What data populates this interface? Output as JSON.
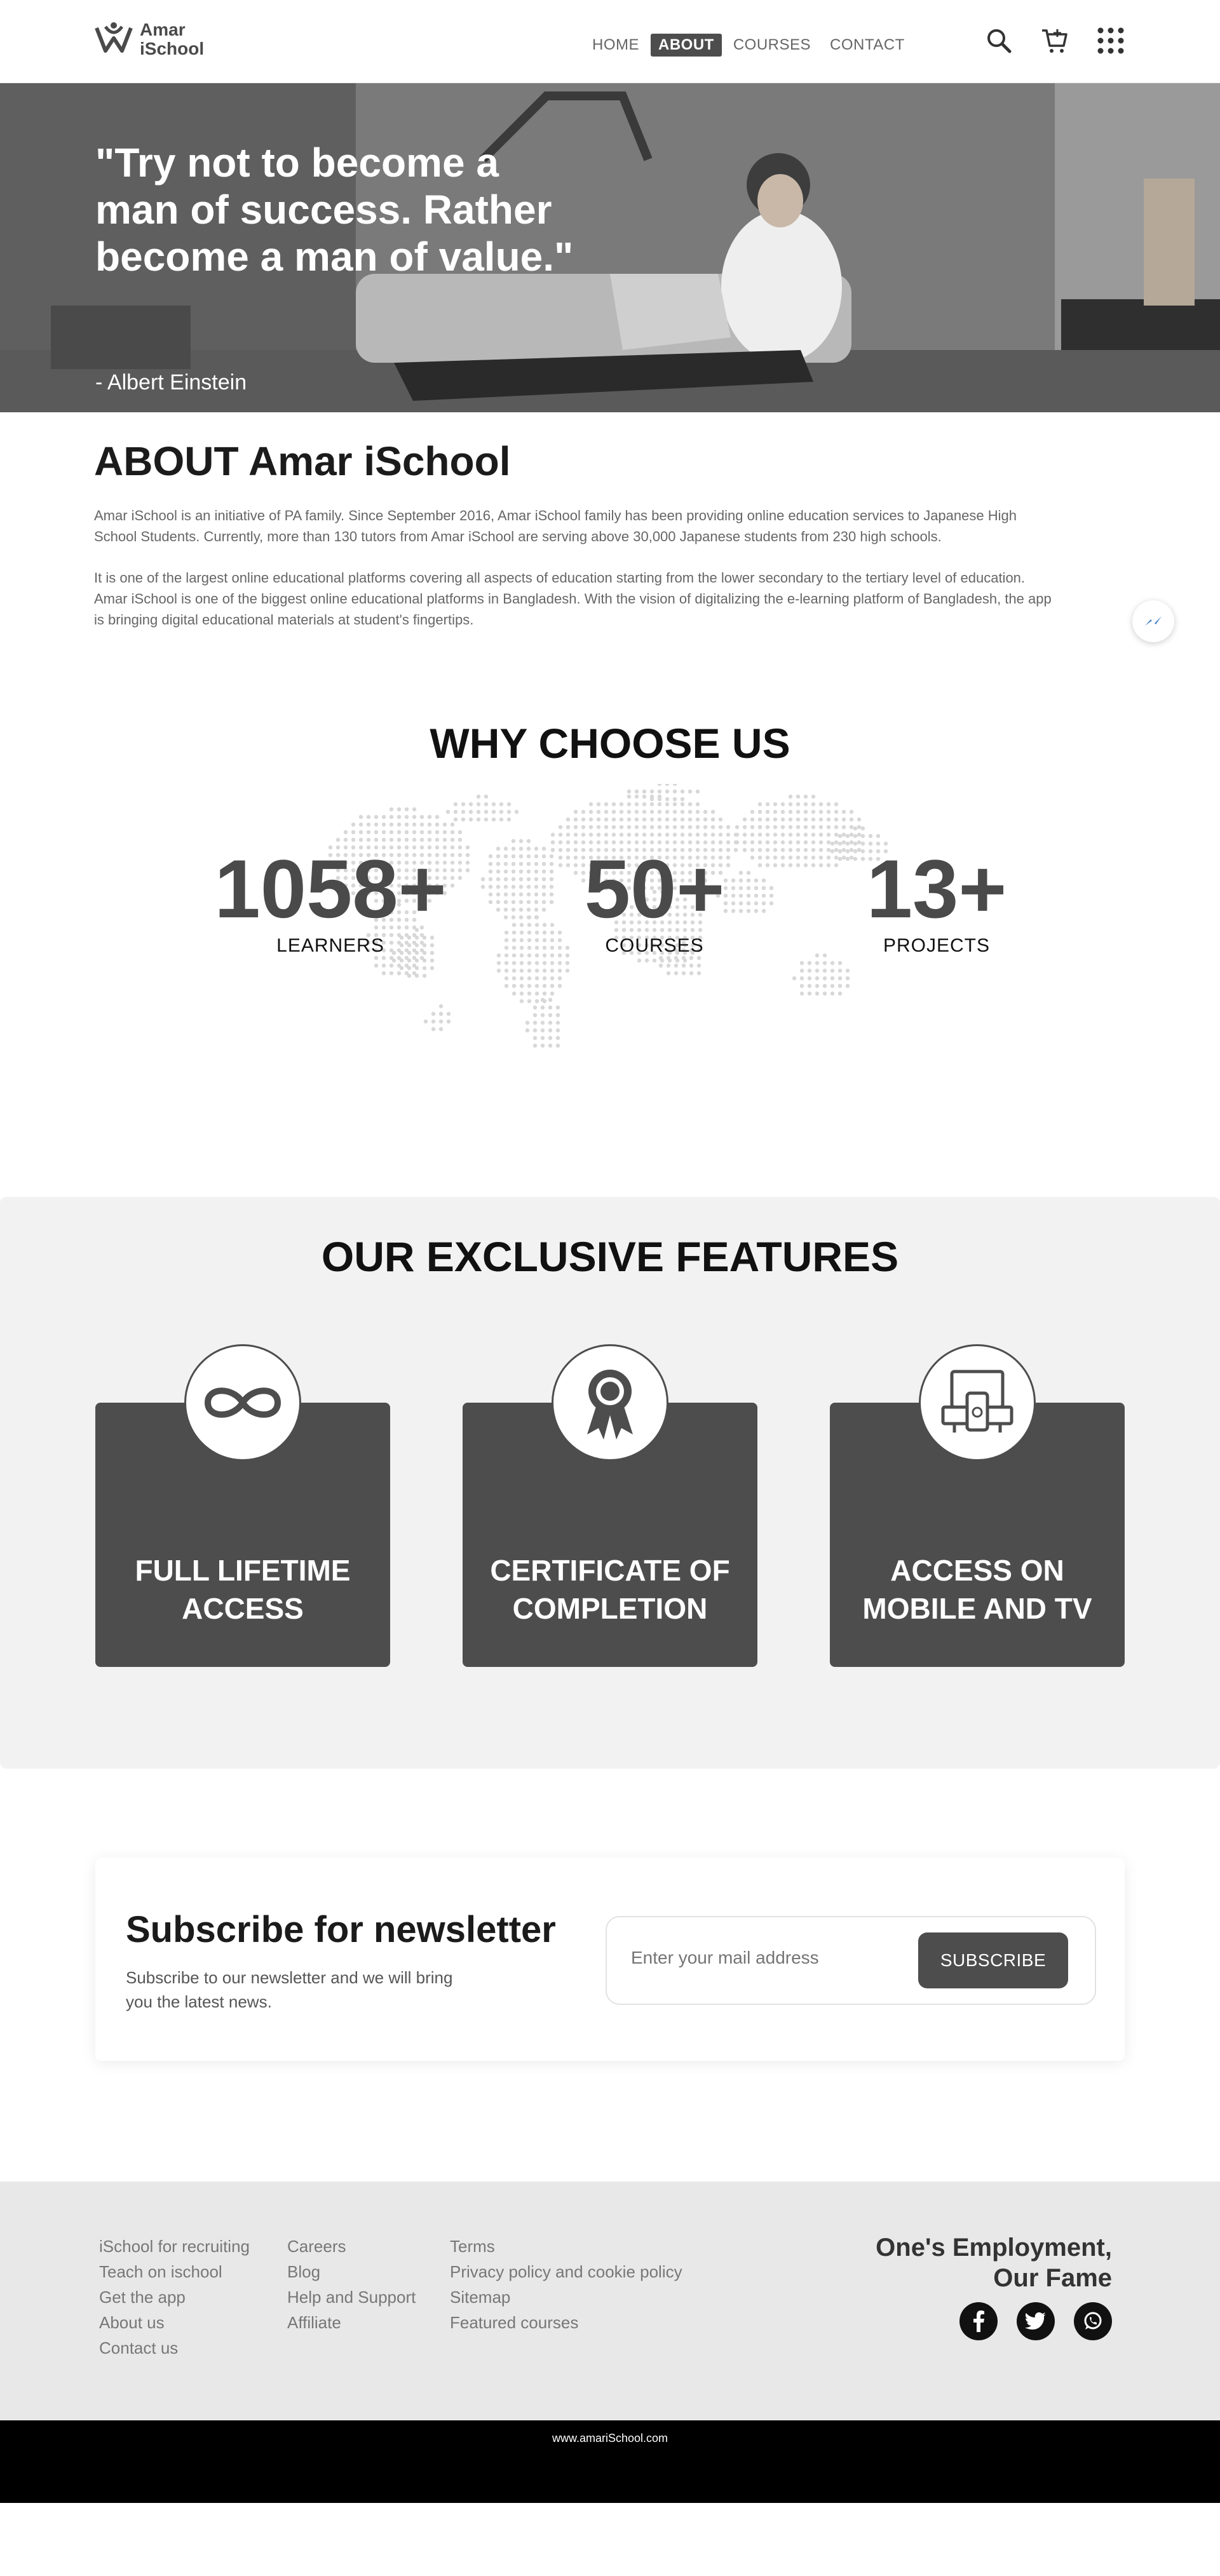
{
  "header": {
    "logo_line1": "Amar",
    "logo_line2": "iSchool",
    "nav": [
      "HOME",
      "ABOUT",
      "COURSES",
      "CONTACT"
    ],
    "active_nav": "ABOUT",
    "icons": [
      "search-icon",
      "cart-icon",
      "apps-grid-icon"
    ]
  },
  "hero": {
    "quote": "\"Try not to become a man of success. Rather become a man of value.\"",
    "author": "- Albert Einstein"
  },
  "about": {
    "title": "ABOUT Amar iSchool",
    "paragraph1": "Amar iSchool is an initiative of PA family. Since September 2016, Amar iSchool family has been providing online education services to Japanese High School Students. Currently, more than 130 tutors from Amar iSchool are serving above 30,000 Japanese students from 230 high schools.",
    "paragraph2": "It is one of the largest online educational platforms covering all aspects of education starting from the lower secondary to the tertiary level of education. Amar iSchool is one of the biggest online educational platforms in Bangladesh. With the vision of digitalizing the e-learning platform of Bangladesh, the app is bringing digital educational materials at student's fingertips."
  },
  "why": {
    "title": "WHY CHOOSE US",
    "stats": [
      {
        "value": "1058+",
        "label": "LEARNERS"
      },
      {
        "value": "50+",
        "label": "COURSES"
      },
      {
        "value": "13+",
        "label": "PROJECTS"
      }
    ]
  },
  "features": {
    "title": "OUR EXCLUSIVE FEATURES",
    "cards": [
      {
        "title_line1": "FULL LIFETIME",
        "title_line2": "ACCESS",
        "icon": "infinity-icon"
      },
      {
        "title_line1": "CERTIFICATE OF",
        "title_line2": "COMPLETION",
        "icon": "award-ribbon-icon"
      },
      {
        "title_line1": "ACCESS ON",
        "title_line2": "MOBILE AND TV",
        "icon": "tv-mobile-icon"
      }
    ]
  },
  "newsletter": {
    "title": "Subscribe for newsletter",
    "subtitle": "Subscribe to our newsletter and we will bring you the latest news.",
    "placeholder": "Enter your mail address",
    "button": "SUBSCRIBE"
  },
  "footer": {
    "col1": [
      "iSchool for recruiting",
      "Teach on ischool",
      "Get the app",
      "About us",
      "Contact us"
    ],
    "col2": [
      "Careers",
      "Blog",
      "Help and Support",
      "Affiliate"
    ],
    "col3": [
      "Terms",
      "Privacy policy and cookie policy",
      "Sitemap",
      "Featured courses"
    ],
    "slogan_line1": "One's Employment,",
    "slogan_line2": "Our Fame",
    "social": [
      "facebook-icon",
      "twitter-icon",
      "whatsapp-icon"
    ],
    "copyright": "www.amariSchool.com"
  },
  "colors": {
    "dark_gray": "#4d4d4d",
    "feature_bg": "#f2f2f2",
    "footer_bg": "#e8e8e8"
  }
}
